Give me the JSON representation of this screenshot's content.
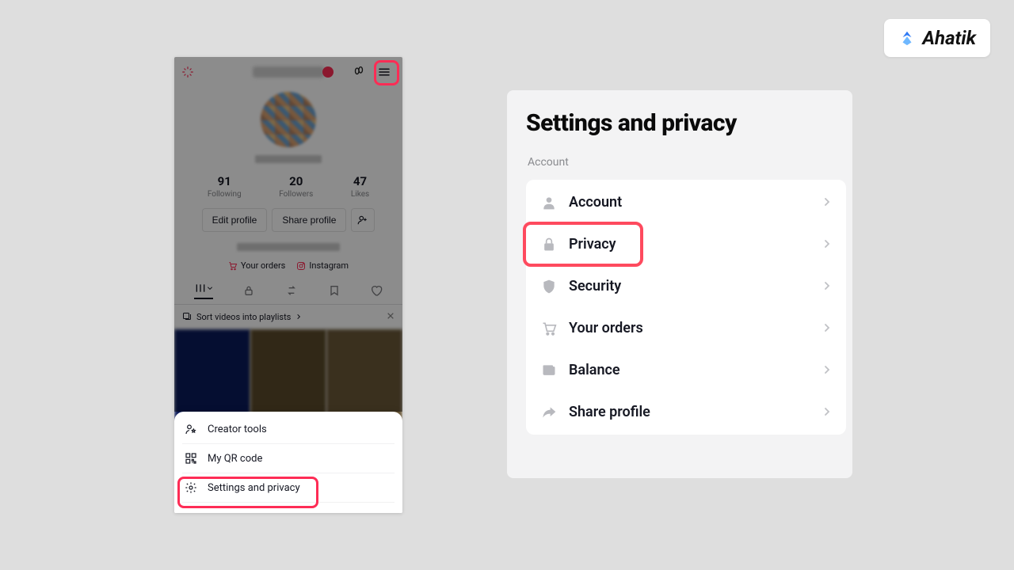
{
  "brand": {
    "name": "Ahatik"
  },
  "profile": {
    "stats": {
      "following": {
        "count": "91",
        "label": "Following"
      },
      "followers": {
        "count": "20",
        "label": "Followers"
      },
      "likes": {
        "count": "47",
        "label": "Likes"
      }
    },
    "actions": {
      "edit_label": "Edit profile",
      "share_label": "Share profile"
    },
    "links": {
      "orders": "Your orders",
      "instagram": "Instagram"
    },
    "sort_hint": "Sort videos into playlists"
  },
  "sheet": {
    "items": [
      {
        "label": "Creator tools"
      },
      {
        "label": "My QR code"
      },
      {
        "label": "Settings and privacy"
      }
    ]
  },
  "settings": {
    "title": "Settings and privacy",
    "section": "Account",
    "items": [
      {
        "label": "Account"
      },
      {
        "label": "Privacy"
      },
      {
        "label": "Security"
      },
      {
        "label": "Your orders"
      },
      {
        "label": "Balance"
      },
      {
        "label": "Share profile"
      }
    ]
  },
  "highlight_color": "#fe2c55"
}
